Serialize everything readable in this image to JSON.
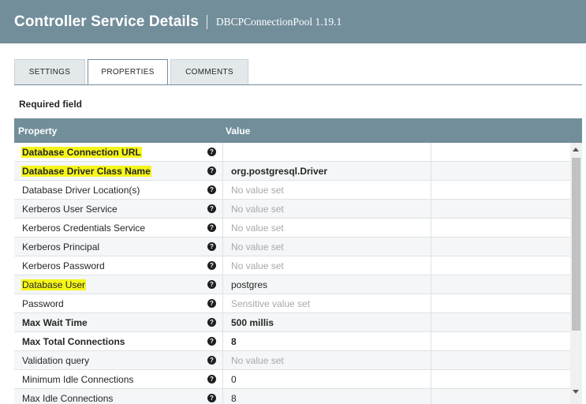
{
  "header": {
    "title": "Controller Service Details",
    "subtitle": "DBCPConnectionPool 1.19.1"
  },
  "tabs": [
    {
      "label": "SETTINGS",
      "active": false
    },
    {
      "label": "PROPERTIES",
      "active": true
    },
    {
      "label": "COMMENTS",
      "active": false
    }
  ],
  "required_label": "Required field",
  "table": {
    "col_property": "Property",
    "col_value": "Value",
    "rows": [
      {
        "name": "Database Connection URL",
        "value": "",
        "required": true,
        "highlighted": true
      },
      {
        "name": "Database Driver Class Name",
        "value": "org.postgresql.Driver",
        "required": true,
        "highlighted": true
      },
      {
        "name": "Database Driver Location(s)",
        "value": "No value set",
        "required": false,
        "highlighted": false
      },
      {
        "name": "Kerberos User Service",
        "value": "No value set",
        "required": false,
        "highlighted": false
      },
      {
        "name": "Kerberos Credentials Service",
        "value": "No value set",
        "required": false,
        "highlighted": false
      },
      {
        "name": "Kerberos Principal",
        "value": "No value set",
        "required": false,
        "highlighted": false
      },
      {
        "name": "Kerberos Password",
        "value": "No value set",
        "required": false,
        "highlighted": false
      },
      {
        "name": "Database User",
        "value": "postgres",
        "required": false,
        "highlighted": true
      },
      {
        "name": "Password",
        "value": "Sensitive value set",
        "required": false,
        "highlighted": false
      },
      {
        "name": "Max Wait Time",
        "value": "500 millis",
        "required": true,
        "highlighted": false
      },
      {
        "name": "Max Total Connections",
        "value": "8",
        "required": true,
        "highlighted": false
      },
      {
        "name": "Validation query",
        "value": "No value set",
        "required": false,
        "highlighted": false
      },
      {
        "name": "Minimum Idle Connections",
        "value": "0",
        "required": false,
        "highlighted": false
      },
      {
        "name": "Max Idle Connections",
        "value": "8",
        "required": false,
        "highlighted": false
      }
    ]
  },
  "icons": {
    "help": "question-circle-icon",
    "scroll_up": "arrow-up-icon",
    "scroll_down": "arrow-down-icon"
  },
  "colors": {
    "header_bg": "#728e9b",
    "highlight": "#f5f519",
    "placeholder_text": "#a8a8a8"
  }
}
